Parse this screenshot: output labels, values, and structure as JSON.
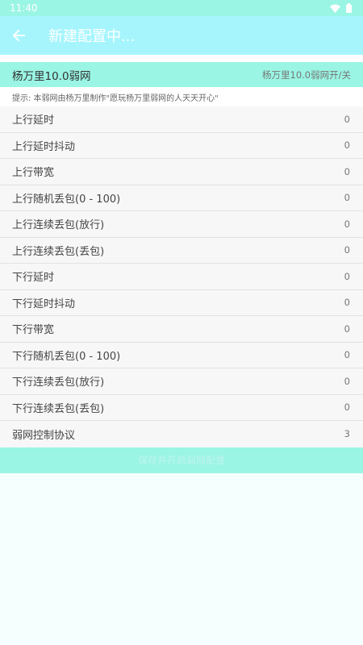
{
  "status_bar": {
    "time": "11:40"
  },
  "app_bar": {
    "title": "新建配置中..."
  },
  "switch": {
    "title": "杨万里10.0弱网",
    "state_label": "杨万里10.0弱网开/关"
  },
  "hint": "提示: 本弱网由杨万里制作\"愿玩杨万里弱网的人天天开心\"",
  "settings": [
    {
      "label": "上行延时",
      "value": "0"
    },
    {
      "label": "上行延时抖动",
      "value": "0"
    },
    {
      "label": "上行带宽",
      "value": "0"
    },
    {
      "label": "上行随机丢包(0 - 100)",
      "value": "0"
    },
    {
      "label": "上行连续丢包(放行)",
      "value": "0"
    },
    {
      "label": "上行连续丢包(丢包)",
      "value": "0"
    },
    {
      "label": "下行延时",
      "value": "0"
    },
    {
      "label": "下行延时抖动",
      "value": "0"
    },
    {
      "label": "下行带宽",
      "value": "0"
    },
    {
      "label": "下行随机丢包(0 - 100)",
      "value": "0"
    },
    {
      "label": "下行连续丢包(放行)",
      "value": "0"
    },
    {
      "label": "下行连续丢包(丢包)",
      "value": "0"
    },
    {
      "label": "弱网控制协议",
      "value": "3"
    }
  ],
  "start_button": {
    "label": "保存并开启弱网配置"
  },
  "colors": {
    "app_bar": "#a6f5fd",
    "accent": "#9af5e4",
    "background": "#f4fffe"
  }
}
